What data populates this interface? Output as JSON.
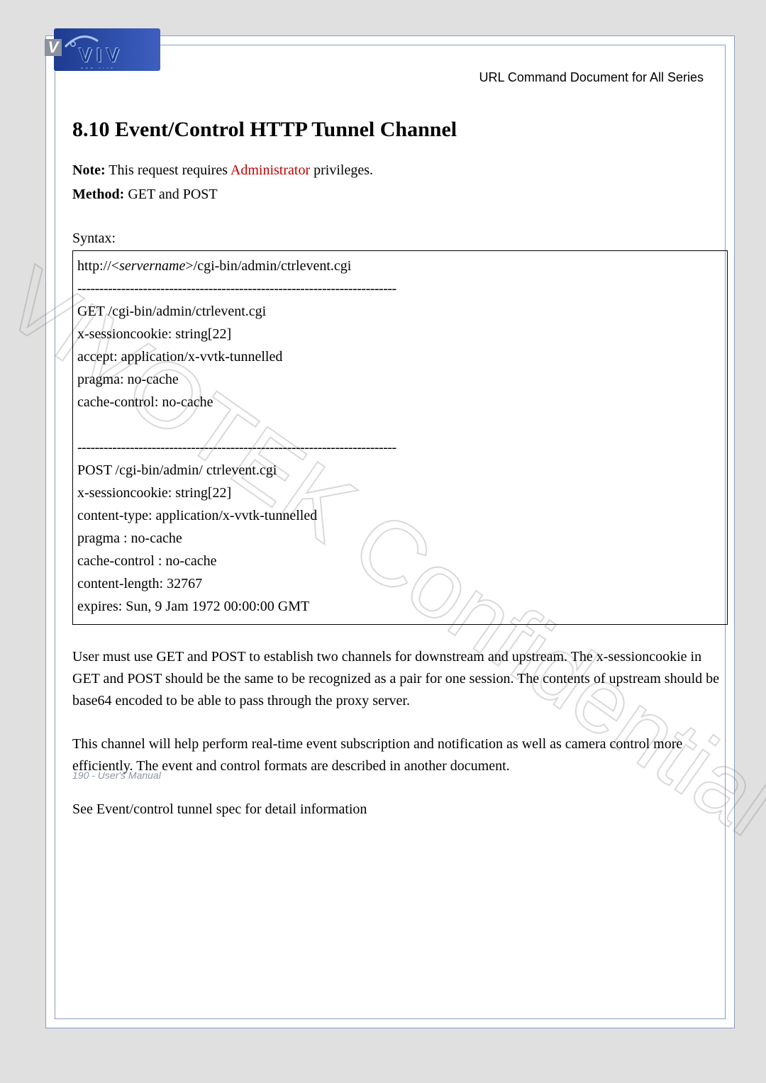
{
  "header": {
    "doc_title": "URL Command Document for All Series",
    "ear_letter": "V",
    "logo_text": "VIV",
    "logo_sub": "www.vive"
  },
  "section": {
    "heading": "8.10 Event/Control HTTP Tunnel Channel",
    "note_label": "Note:",
    "note_text_before": " This request requires ",
    "note_admin": "Administrator",
    "note_text_after": " privileges.",
    "method_label": "Method:",
    "method_value": " GET and POST",
    "syntax_label": "Syntax:"
  },
  "syntax_box": {
    "url_prefix": "http://<",
    "url_servername": "servername",
    "url_suffix": ">/cgi-bin/admin/ctrlevent.cgi",
    "dashes": "-------------------------------------------------------------------------",
    "get_block": [
      "GET /cgi-bin/admin/ctrlevent.cgi",
      "x-sessioncookie: string[22]",
      "accept: application/x-vvtk-tunnelled",
      "pragma: no-cache",
      "cache-control: no-cache"
    ],
    "post_block": [
      "POST /cgi-bin/admin/ ctrlevent.cgi",
      "x-sessioncookie: string[22]",
      "content-type: application/x-vvtk-tunnelled",
      "pragma : no-cache",
      "cache-control : no-cache",
      "content-length: 32767",
      "expires: Sun, 9 Jam 1972 00:00:00 GMT"
    ]
  },
  "body_paragraphs": {
    "p1": "User must use GET and POST to establish two channels for downstream and upstream. The x-sessioncookie in GET and POST should be the same to be recognized as a pair for one session. The contents of upstream should be base64 encoded to be able to pass through the proxy server.",
    "p2": "This channel will help perform real-time event subscription and notification as well as camera control more efficiently. The event and control formats are described in another document.",
    "p3": "See Event/control tunnel spec for detail information"
  },
  "watermark": "VIVOTEK Confidential",
  "footer": "190 - User's Manual"
}
